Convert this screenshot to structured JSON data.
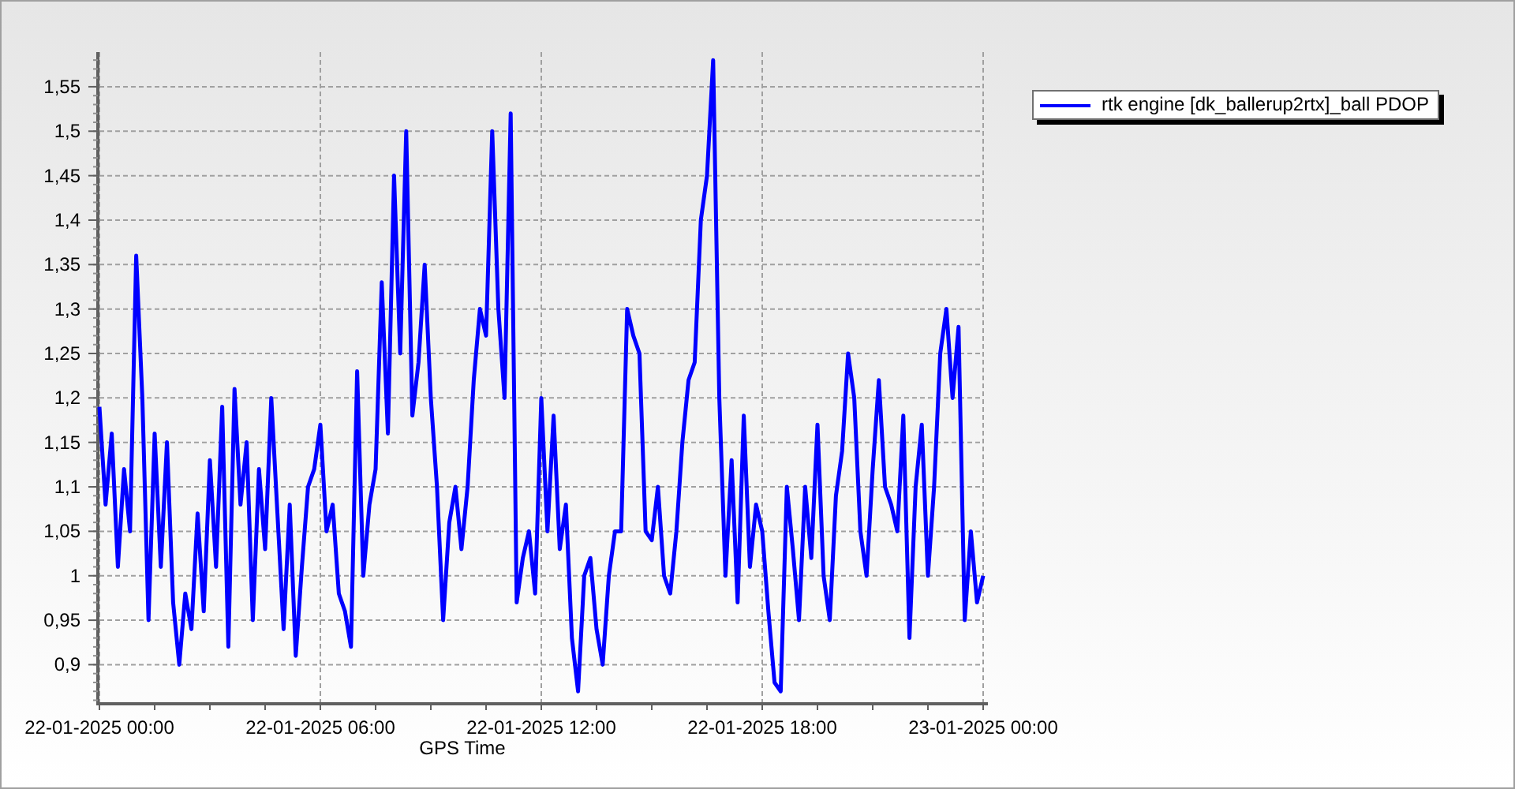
{
  "chart_data": {
    "type": "line",
    "grid": true,
    "xlabel": "GPS Time",
    "ylim": [
      0.856,
      1.589
    ],
    "yticks": [
      {
        "value": 0.9,
        "label": "0,9"
      },
      {
        "value": 0.95,
        "label": "0,95"
      },
      {
        "value": 1,
        "label": "1"
      },
      {
        "value": 1.05,
        "label": "1,05"
      },
      {
        "value": 1.1,
        "label": "1,1"
      },
      {
        "value": 1.15,
        "label": "1,15"
      },
      {
        "value": 1.2,
        "label": "1,2"
      },
      {
        "value": 1.25,
        "label": "1,25"
      },
      {
        "value": 1.3,
        "label": "1,3"
      },
      {
        "value": 1.35,
        "label": "1,35"
      },
      {
        "value": 1.4,
        "label": "1,4"
      },
      {
        "value": 1.45,
        "label": "1,45"
      },
      {
        "value": 1.5,
        "label": "1,5"
      },
      {
        "value": 1.55,
        "label": "1,55"
      }
    ],
    "categories": [
      "22-01-2025 00:00",
      null,
      null,
      null,
      null,
      null,
      null,
      null,
      null,
      null,
      null,
      null,
      null,
      null,
      null,
      null,
      null,
      null,
      null,
      null,
      null,
      null,
      null,
      null,
      null,
      null,
      null,
      null,
      null,
      null,
      null,
      null,
      null,
      null,
      null,
      null,
      "22-01-2025 06:00",
      null,
      null,
      null,
      null,
      null,
      null,
      null,
      null,
      null,
      null,
      null,
      null,
      null,
      null,
      null,
      null,
      null,
      null,
      null,
      null,
      null,
      null,
      null,
      null,
      null,
      null,
      null,
      null,
      null,
      null,
      null,
      null,
      null,
      null,
      null,
      "22-01-2025 12:00",
      null,
      null,
      null,
      null,
      null,
      null,
      null,
      null,
      null,
      null,
      null,
      null,
      null,
      null,
      null,
      null,
      null,
      null,
      null,
      null,
      null,
      null,
      null,
      null,
      null,
      null,
      null,
      null,
      null,
      null,
      null,
      null,
      null,
      null,
      null,
      "22-01-2025 18:00",
      null,
      null,
      null,
      null,
      null,
      null,
      null,
      null,
      null,
      null,
      null,
      null,
      null,
      null,
      null,
      null,
      null,
      null,
      null,
      null,
      null,
      null,
      null,
      null,
      null,
      null,
      null,
      null,
      null,
      null,
      null,
      null,
      null,
      null,
      null,
      "23-01-2025 00:00"
    ],
    "series": [
      {
        "name": "rtk engine [dk_ballerup2rtx]_ball PDOP",
        "color": "#0000ff",
        "values": [
          1.19,
          1.08,
          1.16,
          1.01,
          1.12,
          1.05,
          1.36,
          1.2,
          0.95,
          1.16,
          1.01,
          1.15,
          0.97,
          0.9,
          0.98,
          0.94,
          1.07,
          0.96,
          1.13,
          1.01,
          1.19,
          0.92,
          1.21,
          1.08,
          1.15,
          0.95,
          1.12,
          1.03,
          1.2,
          1.07,
          0.94,
          1.08,
          0.91,
          1.01,
          1.1,
          1.12,
          1.17,
          1.05,
          1.08,
          0.98,
          0.96,
          0.92,
          1.23,
          1.0,
          1.08,
          1.12,
          1.33,
          1.16,
          1.45,
          1.25,
          1.5,
          1.18,
          1.24,
          1.35,
          1.2,
          1.1,
          0.95,
          1.06,
          1.1,
          1.03,
          1.1,
          1.22,
          1.3,
          1.27,
          1.5,
          1.3,
          1.2,
          1.52,
          0.97,
          1.02,
          1.05,
          0.98,
          1.2,
          1.05,
          1.18,
          1.03,
          1.08,
          0.93,
          0.87,
          1.0,
          1.02,
          0.94,
          0.9,
          1.0,
          1.05,
          1.05,
          1.3,
          1.27,
          1.25,
          1.05,
          1.04,
          1.1,
          1.0,
          0.98,
          1.05,
          1.15,
          1.22,
          1.24,
          1.4,
          1.45,
          1.58,
          1.2,
          1.0,
          1.13,
          0.97,
          1.18,
          1.01,
          1.08,
          1.05,
          0.96,
          0.88,
          0.87,
          1.1,
          1.03,
          0.95,
          1.1,
          1.02,
          1.17,
          1.0,
          0.95,
          1.09,
          1.14,
          1.25,
          1.2,
          1.05,
          1.0,
          1.12,
          1.22,
          1.1,
          1.08,
          1.05,
          1.18,
          0.93,
          1.1,
          1.17,
          1.0,
          1.1,
          1.25,
          1.3,
          1.2,
          1.28,
          0.95,
          1.05,
          0.97,
          1.0
        ]
      }
    ]
  }
}
